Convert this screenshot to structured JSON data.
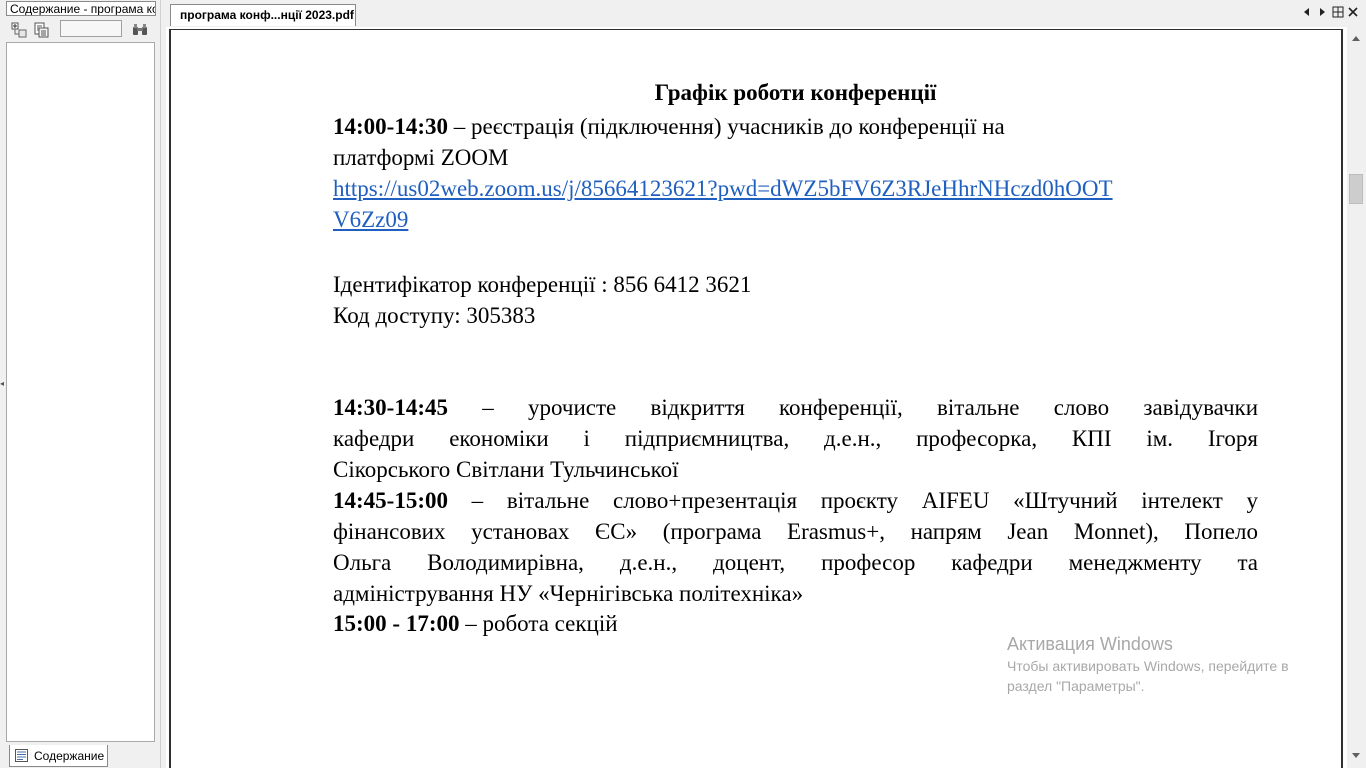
{
  "sidebar": {
    "tab_title": "Содержание - програма ко",
    "bottom_tab_label": "Содержание",
    "collapse_glyph": "◂"
  },
  "document": {
    "tab_title": "програма конф...нції 2023.pdf",
    "title": "Графік роботи конференції",
    "reg_time": "14:00-14:30",
    "reg_text": " – реєстрація (підключення) учасників до конференції на",
    "reg_text2": "платформі   ZOOM",
    "zoom_link_1": "https://us02web.zoom.us/j/85664123621?pwd=dWZ5bFV6Z3RJeHhrNHczd0hOOT",
    "zoom_link_2": "V6Zz09",
    "conf_id": "Ідентифікатор конференції : 856 6412 3621",
    "access_code": "Код доступу: 305383",
    "open_time": "14:30-14:45",
    "open_line1": "– урочисте відкриття конференції, вітальне слово завідувачки",
    "open_line2": "кафедри економіки і підприємництва, д.е.н., професорка, КПІ ім. Ігоря",
    "open_line3": "Сікорського Світлани Тульчинської",
    "welcome_time": "14:45-15:00",
    "welcome_line1": " – вітальне слово+презентація проєкту AIFEU «Штучний інтелект у",
    "welcome_line2": "фінансових установах ЄС» (програма Erasmus+, напрям Jean Monnet),  Попело",
    "welcome_line3": "Ольга Володимирівна, д.е.н., доцент, професор кафедри менеджменту та",
    "welcome_line4": "адміністрування НУ «Чернігівська політехніка»",
    "sections_time": "15:00 - 17:00",
    "sections_text": " – робота  секцій"
  },
  "watermark": {
    "title": "Активация Windows",
    "text": "Чтобы активировать Windows, перейдите в раздел \"Параметры\"."
  },
  "colors": {
    "link": "#1f5fbf",
    "watermark": "#a8a8a8"
  }
}
